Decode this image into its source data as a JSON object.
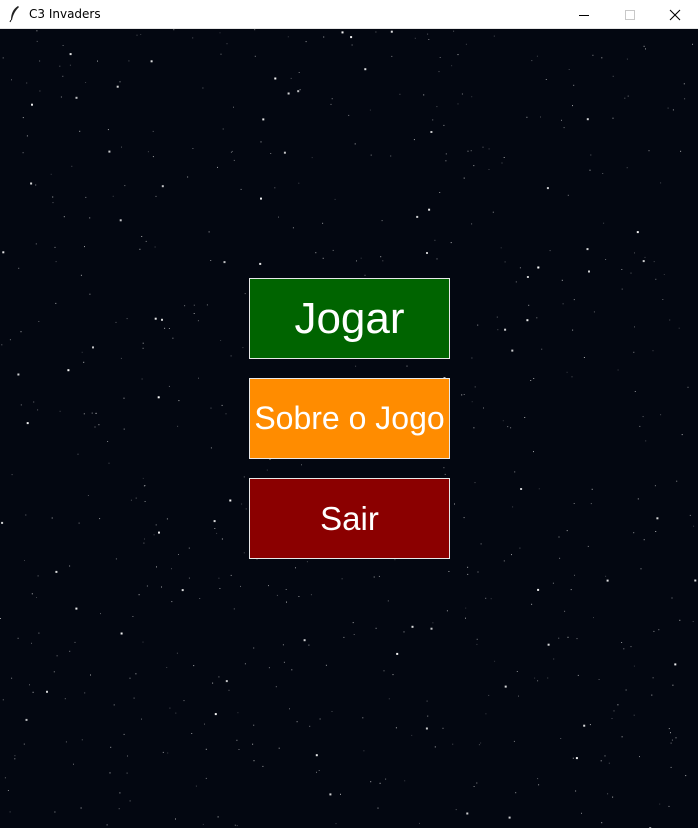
{
  "window": {
    "title": "C3 Invaders",
    "icons": [
      "feather-icon",
      "minimize-icon",
      "maximize-icon",
      "close-icon"
    ]
  },
  "menu": {
    "play": {
      "label": "Jogar",
      "color": "#006400"
    },
    "about": {
      "label": "Sobre o Jogo",
      "color": "#FF8C00"
    },
    "quit": {
      "label": "Sair",
      "color": "#8B0000"
    }
  },
  "background": {
    "color": "#030711",
    "star_color": "#ffffff"
  }
}
